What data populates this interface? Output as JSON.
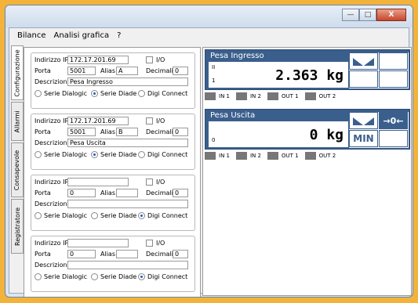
{
  "window": {
    "minimize": "—",
    "maximize": "□",
    "close": "X"
  },
  "menu": [
    "Bilance",
    "Analisi grafica",
    "?"
  ],
  "tabs": [
    "Configurazione",
    "Allarmi",
    "Consapevole",
    "Registratore"
  ],
  "groups": [
    {
      "ip_label": "Indirizzo IP",
      "ip": "172.17.201.69",
      "io": "I/O",
      "port_label": "Porta",
      "port": "5001",
      "alias_label": "Alias",
      "alias": "A",
      "dec_label": "Decimali",
      "dec": "0",
      "desc_label": "Descrizione",
      "desc": "Pesa Ingresso",
      "radios": [
        "Serie Dialogic",
        "Serie Diade",
        "Digi Connect"
      ],
      "selected": 1
    },
    {
      "ip_label": "Indirizzo IP",
      "ip": "172.17.201.69",
      "io": "I/O",
      "port_label": "Porta",
      "port": "5001",
      "alias_label": "Alias",
      "alias": "B",
      "dec_label": "Decimali",
      "dec": "0",
      "desc_label": "Descrizione",
      "desc": "Pesa Uscita",
      "radios": [
        "Serie Dialogic",
        "Serie Diade",
        "Digi Connect"
      ],
      "selected": 1
    },
    {
      "ip_label": "Indirizzo IP",
      "ip": "",
      "io": "I/O",
      "port_label": "Porta",
      "port": "0",
      "alias_label": "Alias",
      "alias": "",
      "dec_label": "Decimali",
      "dec": "0",
      "desc_label": "Descrizione",
      "desc": "",
      "radios": [
        "Serie Dialogic",
        "Serie Diade",
        "Digi Connect"
      ],
      "selected": 2
    },
    {
      "ip_label": "Indirizzo IP",
      "ip": "",
      "io": "I/O",
      "port_label": "Porta",
      "port": "0",
      "alias_label": "Alias",
      "alias": "",
      "dec_label": "Decimali",
      "dec": "0",
      "desc_label": "Descrizione",
      "desc": "",
      "radios": [
        "Serie Dialogic",
        "Serie Diade",
        "Digi Connect"
      ],
      "selected": 2
    }
  ],
  "scales": [
    {
      "title": "Pesa Ingresso",
      "weight": "2.363 kg",
      "small_top": "II",
      "small_bottom": "1",
      "min_label": "",
      "zero_label": "",
      "io": [
        "IN 1",
        "IN 2",
        "OUT 1",
        "OUT 2"
      ]
    },
    {
      "title": "Pesa Uscita",
      "weight": "0 kg",
      "small_top": "",
      "small_bottom": "0",
      "min_label": "MIN",
      "zero_label": "→0←",
      "io": [
        "IN 1",
        "IN 2",
        "OUT 1",
        "OUT 2"
      ]
    }
  ],
  "colors": {
    "panel": "#3b5f8d",
    "frame": "#f3b23a"
  }
}
